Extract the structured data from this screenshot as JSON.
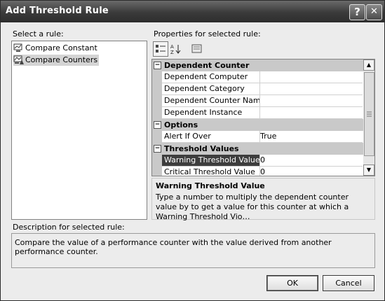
{
  "window": {
    "title": "Add Threshold Rule",
    "help_glyph": "?",
    "close_glyph": "✕"
  },
  "left": {
    "label": "Select a rule:",
    "rules": [
      {
        "label": "Compare Constant",
        "icon": "compare-constant-rule-icon"
      },
      {
        "label": "Compare Counters",
        "icon": "compare-counters-rule-icon",
        "selected": true
      }
    ]
  },
  "properties": {
    "label": "Properties for selected rule:",
    "toolbar": [
      "categorized-sort-icon",
      "alphabetical-sort-icon",
      "property-pages-icon"
    ],
    "categories": [
      {
        "name": "Dependent Counter",
        "toggle": "⊟",
        "rows": [
          {
            "name": "Dependent Computer",
            "value": ""
          },
          {
            "name": "Dependent Category",
            "value": ""
          },
          {
            "name": "Dependent Counter Name",
            "value": ""
          },
          {
            "name": "Dependent Instance",
            "value": ""
          }
        ]
      },
      {
        "name": "Options",
        "toggle": "⊟",
        "rows": [
          {
            "name": "Alert If Over",
            "value": "True"
          }
        ]
      },
      {
        "name": "Threshold Values",
        "toggle": "⊟",
        "rows": [
          {
            "name": "Warning Threshold Value",
            "value": "0",
            "selected": true
          },
          {
            "name": "Critical Threshold Value",
            "value": "0"
          }
        ]
      }
    ],
    "help": {
      "title": "Warning Threshold Value",
      "text": "Type a number to multiply the dependent counter value by to get a value for this counter at which a Warning Threshold Vio…"
    }
  },
  "description": {
    "label": "Description for selected rule:",
    "text": "Compare the value of a performance counter with the value derived from another performance counter."
  },
  "buttons": {
    "ok": "OK",
    "cancel": "Cancel"
  }
}
